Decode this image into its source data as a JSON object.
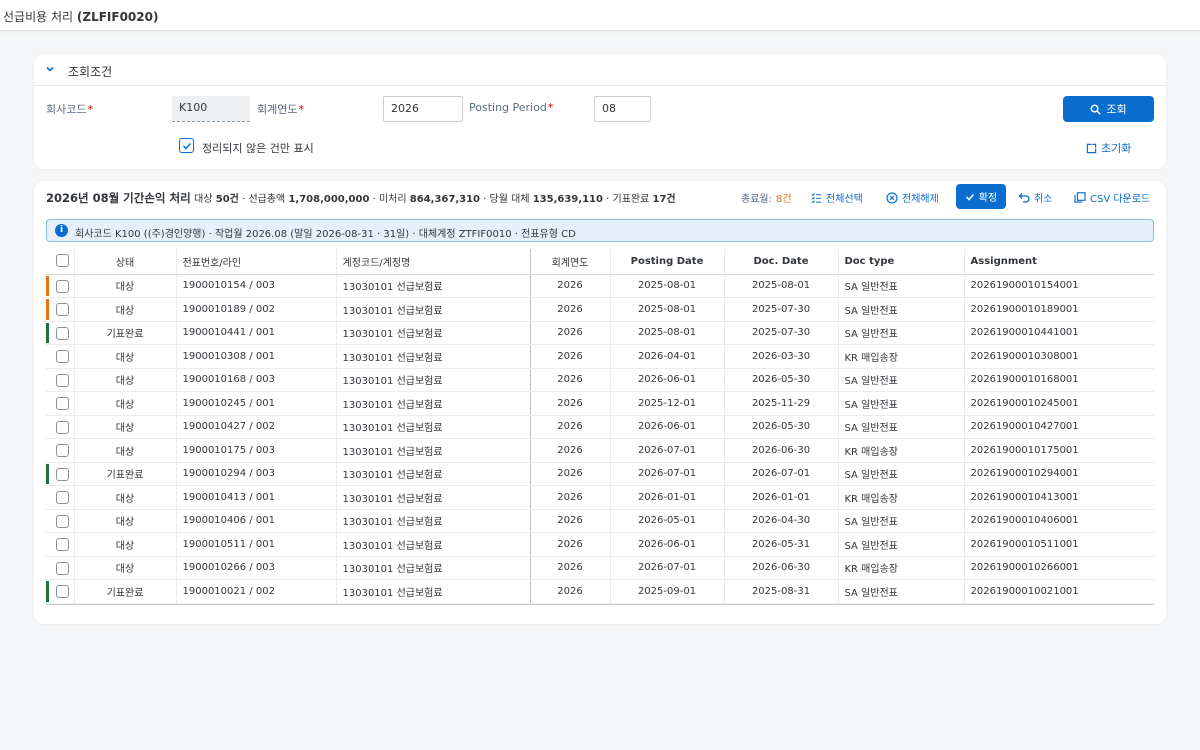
{
  "app": {
    "title": "선급비용 처리",
    "code": "(ZLFIF0020)"
  },
  "filter": {
    "header": "조회조건",
    "company_label": "회사코드",
    "company_value": "K100",
    "fiscal_year_label": "회계연도",
    "fiscal_year_value": "2026",
    "period_label": "Posting Period",
    "period_value": "08",
    "unsettled_only_label": "정리되지 않은 건만 표시",
    "unsettled_only_checked": true,
    "search_button": "조회",
    "reset_button": "초기화"
  },
  "results": {
    "title": "2026년 08월 기간손익 처리",
    "summary_target_label": "대상",
    "summary_target_value": "50건",
    "summary_total_label": "선급총액",
    "summary_total_value": "1,708,000,000",
    "summary_unprocessed_label": "미처리",
    "summary_unprocessed_value": "864,367,310",
    "summary_current_label": "당월 대체",
    "summary_current_value": "135,639,110",
    "summary_done_label": "기표완료",
    "summary_done_value": "17건",
    "ended_label": "종료월:",
    "ended_value": "8건",
    "select_all": "전체선택",
    "deselect_all": "전체해제",
    "confirm": "확정",
    "cancel": "취소",
    "csv": "CSV 다운로드"
  },
  "info_message": "회사코드 K100 ((주)경인양행) · 작업월 2026.08 (말일 2026-08-31 · 31일) · 대체계정 ZTFIF0010 · 전표유형 CD",
  "columns": {
    "status": "상태",
    "doc_line": "전표번호/라인",
    "account": "계정코드/계정명",
    "fiscal_year": "회계연도",
    "posting_date": "Posting Date",
    "doc_date": "Doc. Date",
    "doc_type": "Doc type",
    "assignment": "Assignment"
  },
  "colors": {
    "accent": "#0a6ed1",
    "target": "#e9730c",
    "done": "#256f3a"
  },
  "rows": [
    {
      "status": "대상",
      "kind": "target",
      "bar": true,
      "doc": "1900010154 / 003",
      "account": "13030101 선급보험료",
      "year": "2026",
      "posting": "2025-08-01",
      "docdate": "2025-08-01",
      "doctype": "SA 일반전표",
      "assignment": "20261900010154001"
    },
    {
      "status": "대상",
      "kind": "target",
      "bar": true,
      "doc": "1900010189 / 002",
      "account": "13030101 선급보험료",
      "year": "2026",
      "posting": "2025-08-01",
      "docdate": "2025-07-30",
      "doctype": "SA 일반전표",
      "assignment": "20261900010189001"
    },
    {
      "status": "기표완료",
      "kind": "done",
      "bar": true,
      "doc": "1900010441 / 001",
      "account": "13030101 선급보험료",
      "year": "2026",
      "posting": "2025-08-01",
      "docdate": "2025-07-30",
      "doctype": "SA 일반전표",
      "assignment": "20261900010441001"
    },
    {
      "status": "대상",
      "kind": "target",
      "bar": false,
      "doc": "1900010308 / 001",
      "account": "13030101 선급보험료",
      "year": "2026",
      "posting": "2026-04-01",
      "docdate": "2026-03-30",
      "doctype": "KR 매입송장",
      "assignment": "20261900010308001"
    },
    {
      "status": "대상",
      "kind": "target",
      "bar": false,
      "doc": "1900010168 / 003",
      "account": "13030101 선급보험료",
      "year": "2026",
      "posting": "2026-06-01",
      "docdate": "2026-05-30",
      "doctype": "SA 일반전표",
      "assignment": "20261900010168001"
    },
    {
      "status": "대상",
      "kind": "target",
      "bar": false,
      "doc": "1900010245 / 001",
      "account": "13030101 선급보험료",
      "year": "2026",
      "posting": "2025-12-01",
      "docdate": "2025-11-29",
      "doctype": "SA 일반전표",
      "assignment": "20261900010245001"
    },
    {
      "status": "대상",
      "kind": "target",
      "bar": false,
      "doc": "1900010427 / 002",
      "account": "13030101 선급보험료",
      "year": "2026",
      "posting": "2026-06-01",
      "docdate": "2026-05-30",
      "doctype": "SA 일반전표",
      "assignment": "20261900010427001"
    },
    {
      "status": "대상",
      "kind": "target",
      "bar": false,
      "doc": "1900010175 / 003",
      "account": "13030101 선급보험료",
      "year": "2026",
      "posting": "2026-07-01",
      "docdate": "2026-06-30",
      "doctype": "KR 매입송장",
      "assignment": "20261900010175001"
    },
    {
      "status": "기표완료",
      "kind": "done",
      "bar": true,
      "doc": "1900010294 / 003",
      "account": "13030101 선급보험료",
      "year": "2026",
      "posting": "2026-07-01",
      "docdate": "2026-07-01",
      "doctype": "SA 일반전표",
      "assignment": "20261900010294001"
    },
    {
      "status": "대상",
      "kind": "target",
      "bar": false,
      "doc": "1900010413 / 001",
      "account": "13030101 선급보험료",
      "year": "2026",
      "posting": "2026-01-01",
      "docdate": "2026-01-01",
      "doctype": "KR 매입송장",
      "assignment": "20261900010413001"
    },
    {
      "status": "대상",
      "kind": "target",
      "bar": false,
      "doc": "1900010406 / 001",
      "account": "13030101 선급보험료",
      "year": "2026",
      "posting": "2026-05-01",
      "docdate": "2026-04-30",
      "doctype": "SA 일반전표",
      "assignment": "20261900010406001"
    },
    {
      "status": "대상",
      "kind": "target",
      "bar": false,
      "doc": "1900010511 / 001",
      "account": "13030101 선급보험료",
      "year": "2026",
      "posting": "2026-06-01",
      "docdate": "2026-05-31",
      "doctype": "SA 일반전표",
      "assignment": "20261900010511001"
    },
    {
      "status": "대상",
      "kind": "target",
      "bar": false,
      "doc": "1900010266 / 003",
      "account": "13030101 선급보험료",
      "year": "2026",
      "posting": "2026-07-01",
      "docdate": "2026-06-30",
      "doctype": "KR 매입송장",
      "assignment": "20261900010266001"
    },
    {
      "status": "기표완료",
      "kind": "done",
      "bar": true,
      "doc": "1900010021 / 002",
      "account": "13030101 선급보험료",
      "year": "2026",
      "posting": "2025-09-01",
      "docdate": "2025-08-31",
      "doctype": "SA 일반전표",
      "assignment": "20261900010021001"
    }
  ]
}
